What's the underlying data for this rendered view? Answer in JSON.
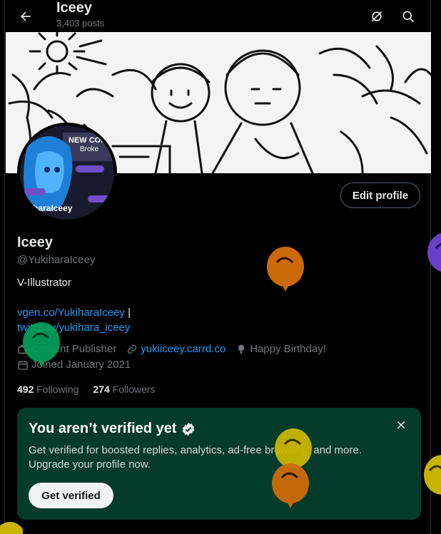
{
  "header": {
    "title": "Iceey",
    "posts": "3,403 posts"
  },
  "banner": {
    "overlay_caption": "NEW CONDI",
    "overlay_sub": "Broke",
    "avatar_name": "kiharaIceey"
  },
  "profile": {
    "edit_label": "Edit profile",
    "name": "Iceey",
    "handle": "@YukiharaIceey",
    "bio": "V-Illustrator",
    "link1": "vgen.co/YukiharaIceey",
    "link_sep": " |",
    "link2": "twitch.tv/yukihara_iceey",
    "category": "Content Publisher",
    "website": "yukiiceey.carrd.co",
    "birthday": "Happy Birthday!",
    "joined": "Joined January 2021",
    "following_count": "492",
    "following_label": "Following",
    "followers_count": "274",
    "followers_label": "Followers"
  },
  "verify_card": {
    "title": "You aren’t verified yet",
    "text": "Get verified for boosted replies, analytics, ad-free browsing, and more. Upgrade your profile now.",
    "button": "Get verified"
  },
  "colors": {
    "accent": "#1d9bf0",
    "card_bg": "#053b2a",
    "balloon_orange": "#cc6a0a",
    "balloon_green": "#00a05a",
    "balloon_yellow": "#c8b400",
    "balloon_purple": "#6a3fc8"
  },
  "icons": [
    "back-arrow-icon",
    "no-notify-icon",
    "search-icon",
    "briefcase-icon",
    "link-icon",
    "balloon-icon",
    "calendar-icon",
    "verified-badge-icon",
    "close-icon"
  ]
}
